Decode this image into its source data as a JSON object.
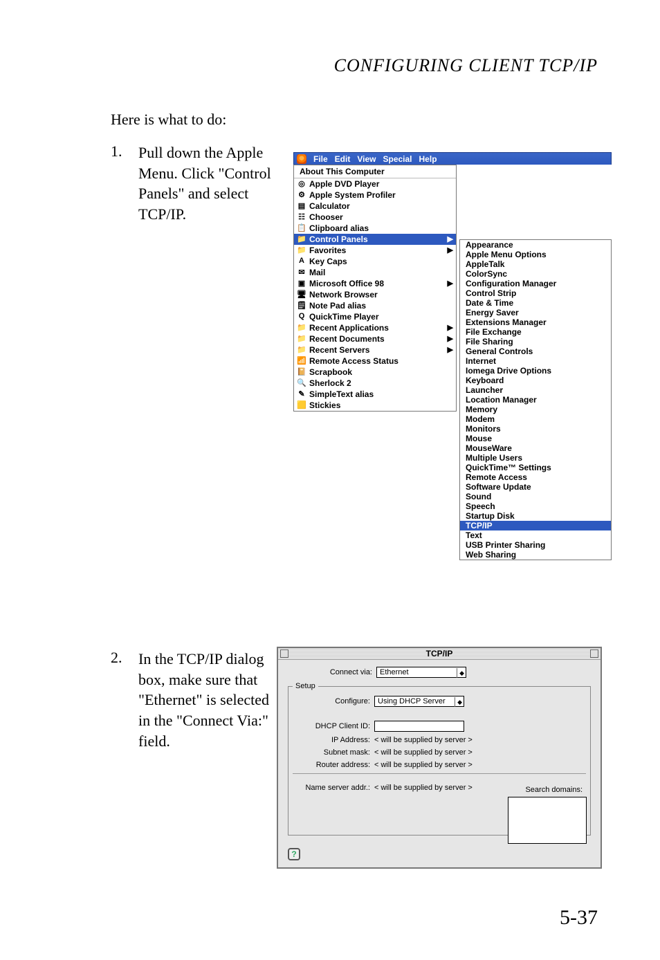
{
  "page": {
    "title": "CONFIGURING CLIENT TCP/IP",
    "intro": "Here is what to do:",
    "number": "5-37"
  },
  "steps": {
    "s1": {
      "num": "1.",
      "text": "Pull down the Apple Menu. Click \"Control Panels\" and select TCP/IP."
    },
    "s2": {
      "num": "2.",
      "text": "In the TCP/IP dialog box, make sure that \"Ethernet\" is selected in the \"Connect Via:\" field."
    }
  },
  "menubar": {
    "file": "File",
    "edit": "Edit",
    "view": "View",
    "special": "Special",
    "help": "Help"
  },
  "apple_menu": {
    "about": "About This Computer",
    "items": [
      "Apple DVD Player",
      "Apple System Profiler",
      "Calculator",
      "Chooser",
      "Clipboard alias",
      "Control Panels",
      "Favorites",
      "Key Caps",
      "Mail",
      "Microsoft Office 98",
      "Network Browser",
      "Note Pad alias",
      "QuickTime Player",
      "Recent Applications",
      "Recent Documents",
      "Recent Servers",
      "Remote Access Status",
      "Scrapbook",
      "Sherlock 2",
      "SimpleText alias",
      "Stickies"
    ]
  },
  "control_panels": [
    "Appearance",
    "Apple Menu Options",
    "AppleTalk",
    "ColorSync",
    "Configuration Manager",
    "Control Strip",
    "Date & Time",
    "Energy Saver",
    "Extensions Manager",
    "File Exchange",
    "File Sharing",
    "General Controls",
    "Internet",
    "Iomega Drive Options",
    "Keyboard",
    "Launcher",
    "Location Manager",
    "Memory",
    "Modem",
    "Monitors",
    "Mouse",
    "MouseWare",
    "Multiple Users",
    "QuickTime™ Settings",
    "Remote Access",
    "Software Update",
    "Sound",
    "Speech",
    "Startup Disk",
    "TCP/IP",
    "Text",
    "USB Printer Sharing",
    "Web Sharing"
  ],
  "tcpip": {
    "title": "TCP/IP",
    "connect_via_label": "Connect via:",
    "connect_via_value": "Ethernet",
    "setup_legend": "Setup",
    "configure_label": "Configure:",
    "configure_value": "Using DHCP Server",
    "dhcp_client_label": "DHCP Client ID:",
    "dhcp_client_value": "",
    "ip_label": "IP Address:",
    "subnet_label": "Subnet mask:",
    "router_label": "Router address:",
    "ns_label": "Name server addr.:",
    "supplied": "< will be supplied by server >",
    "search_domains_label": "Search domains:",
    "help": "?"
  }
}
